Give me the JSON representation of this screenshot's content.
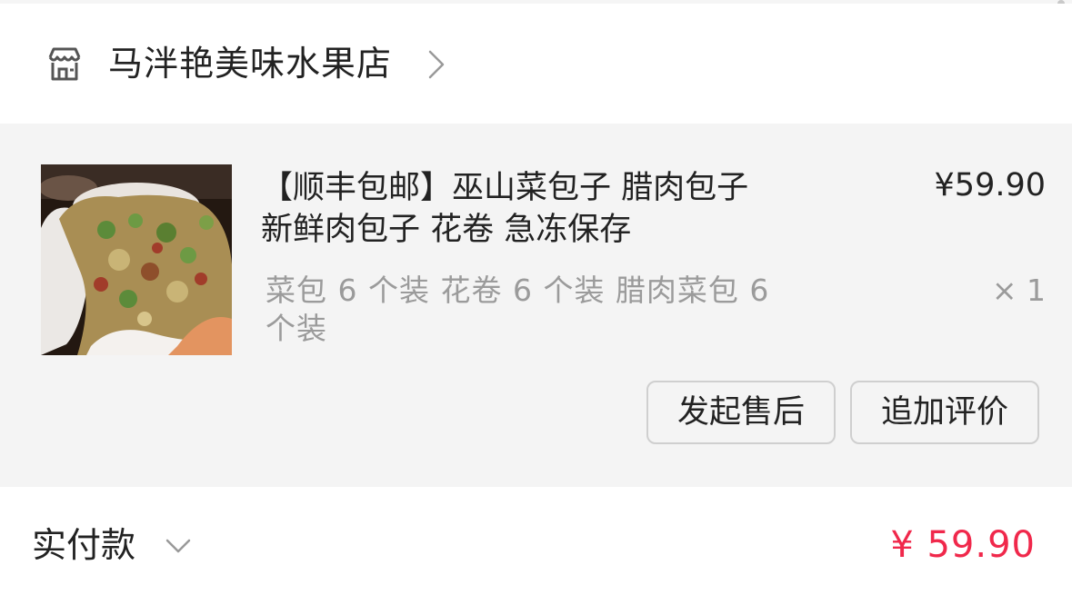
{
  "store": {
    "name": "马泮艳美味水果店",
    "icon": "store-icon",
    "chevron_icon": "chevron-right-icon"
  },
  "product": {
    "title": "【顺丰包邮】巫山菜包子 腊肉包子 新鲜肉包子 花卷 急冻保存",
    "price": "¥59.90",
    "spec": "菜包 6 个装  花卷 6 个装  腊肉菜包 6 个装",
    "quantity": "× 1",
    "image_icon": "product-photo"
  },
  "actions": {
    "after_sale": "发起售后",
    "add_review": "追加评价"
  },
  "payment": {
    "label": "实付款",
    "amount": "¥ 59.90",
    "chevron_icon": "chevron-down-icon"
  },
  "colors": {
    "price_accent": "#f0284b",
    "card_bg": "#f4f4f4",
    "muted_text": "#9b9b9b"
  }
}
